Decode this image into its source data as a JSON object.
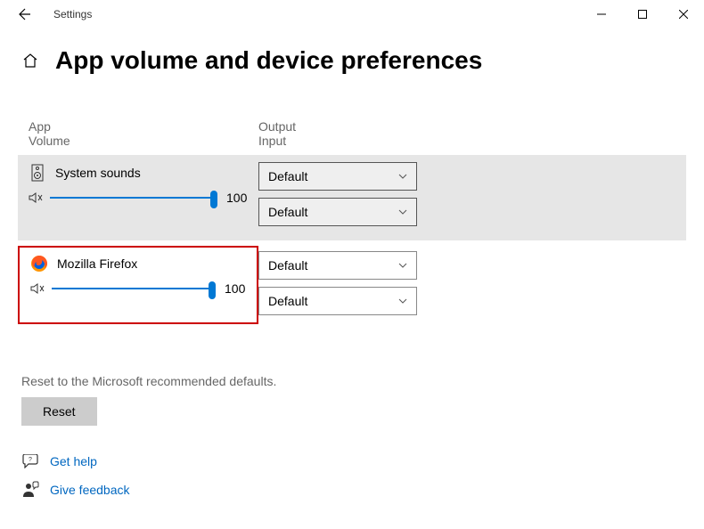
{
  "window": {
    "app_name": "Settings"
  },
  "page": {
    "title": "App volume and device preferences"
  },
  "columns": {
    "left_line1": "App",
    "left_line2": "Volume",
    "right_line1": "Output",
    "right_line2": "Input"
  },
  "apps": [
    {
      "name": "System sounds",
      "volume": "100",
      "output": "Default",
      "input": "Default"
    },
    {
      "name": "Mozilla Firefox",
      "volume": "100",
      "output": "Default",
      "input": "Default"
    }
  ],
  "reset": {
    "description": "Reset to the Microsoft recommended defaults.",
    "button": "Reset"
  },
  "links": {
    "help": "Get help",
    "feedback": "Give feedback"
  }
}
